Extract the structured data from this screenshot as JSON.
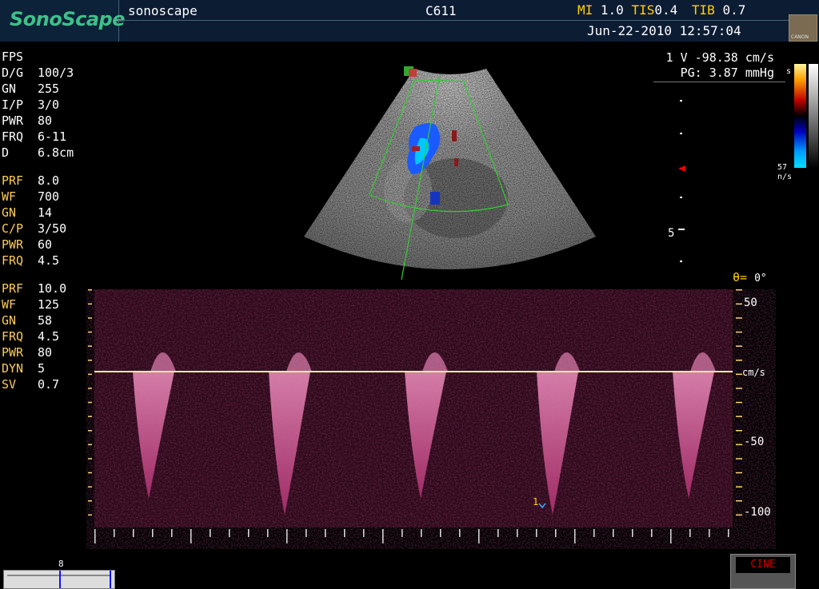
{
  "header": {
    "brand": "SonoScape",
    "hospital": "sonoscape",
    "probe": "C611",
    "mi_label": "MI",
    "mi_value": "1.0",
    "tis_label": "TIS",
    "tis_value": "0.4",
    "tib_label": "TIB",
    "tib_value": "0.7",
    "datetime": "Jun-22-2010 12:57:04",
    "thumb_caption": "CANON"
  },
  "bmode_params": [
    {
      "key": "FPS",
      "value": ""
    },
    {
      "key": "D/G",
      "value": "100/3"
    },
    {
      "key": "GN",
      "value": "255"
    },
    {
      "key": "I/P",
      "value": "3/0"
    },
    {
      "key": "PWR",
      "value": "80"
    },
    {
      "key": "FRQ",
      "value": "6-11"
    },
    {
      "key": "D",
      "value": "6.8cm"
    }
  ],
  "color_params": [
    {
      "key": "PRF",
      "value": "8.0"
    },
    {
      "key": "WF",
      "value": "700"
    },
    {
      "key": "GN",
      "value": "14"
    },
    {
      "key": "C/P",
      "value": "3/50"
    },
    {
      "key": "PWR",
      "value": "60"
    },
    {
      "key": "FRQ",
      "value": "4.5"
    }
  ],
  "pw_params": [
    {
      "key": "PRF",
      "value": "10.0"
    },
    {
      "key": "WF",
      "value": "125"
    },
    {
      "key": "GN",
      "value": "58"
    },
    {
      "key": "FRQ",
      "value": "4.5"
    },
    {
      "key": "PWR",
      "value": "80"
    },
    {
      "key": "DYN",
      "value": "5"
    },
    {
      "key": "SV",
      "value": "0.7"
    }
  ],
  "measurement": {
    "velocity": "1 V -98.38 cm/s",
    "pg": "PG: 3.87 mmHg"
  },
  "depth": {
    "label": "5"
  },
  "color_scale": {
    "top_label": "s",
    "value_label": "57",
    "unit_label": "n/s"
  },
  "angle": {
    "label": "θ=",
    "value": "0°"
  },
  "spectrum": {
    "labels": [
      "50",
      "cm/s",
      "-50",
      "-100"
    ],
    "marker": "1"
  },
  "cine": {
    "label": "CINE"
  },
  "bottom_scale": {
    "label": "8"
  },
  "colors": {
    "header_bg": "#0c1c33",
    "brand": "#3fc08a",
    "accent_yellow": "#ffd200",
    "spectrum": "#c8407a",
    "sample_box": "#33cc33"
  }
}
